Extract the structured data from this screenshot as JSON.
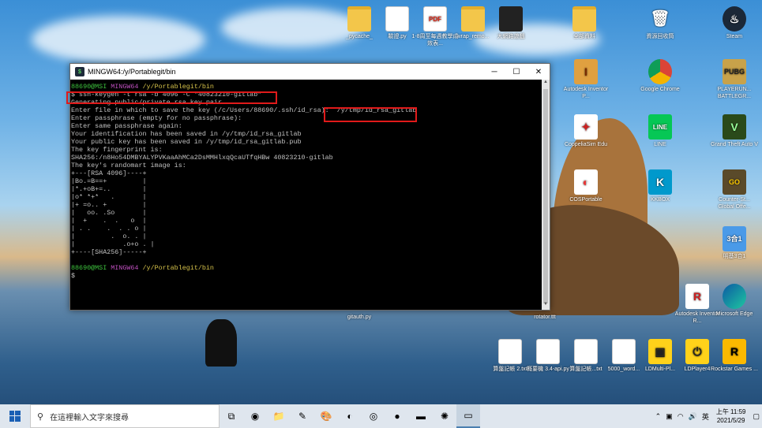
{
  "window": {
    "title": "MINGW64:/y/Portablegit/bin",
    "minimize": "─",
    "maximize": "☐",
    "close": "✕"
  },
  "terminal": {
    "lines": [
      {
        "user": "88690@MSI",
        "env": "MINGW64",
        "path": "/y/Portablegit/bin"
      },
      "$ ssh-keygen -t rsa -b 4096 -C \"40823210-gitlab\"",
      "Generating public/private rsa key pair.",
      "Enter file in which to save the key (/c/Users/88690/.ssh/id_rsa):  /y/tmp/id_rsa_gitlab",
      "Enter passphrase (empty for no passphrase):",
      "Enter same passphrase again:",
      "Your identification has been saved in /y/tmp/id_rsa_gitlab",
      "Your public key has been saved in /y/tmp/id_rsa_gitlab.pub",
      "The key fingerprint is:",
      "SHA256:/n8Ho54DMBYALYPVKaaAhMCa2DsMMHlxqQcaUTfqHBw 40823210-gitlab",
      "The key's randomart image is:",
      "+---[RSA 4096]----+",
      "|Bo.=B==+         |",
      "|*.+oB+=..        |",
      "|o* *+*   .       |",
      "|+ =o.. +         |",
      "|   oo. .So       |",
      "|  +    .  .   o  |",
      "| . .    .  . . o |",
      "|         .  o. . |",
      "|            .o+o . |",
      "+----[SHA256]-----+",
      "",
      {
        "user": "88690@MSI",
        "env": "MINGW64",
        "path": "/y/Portablegit/bin"
      },
      "$"
    ]
  },
  "desktop_icons": [
    {
      "label": "_pycache_",
      "icon": "folder"
    },
    {
      "label": "驗證.py",
      "icon": "doc"
    },
    {
      "label": "1-8周至每週教學成效表...",
      "icon": "pdf"
    },
    {
      "label": "wrap_remo...",
      "icon": "folder"
    },
    {
      "label": "大網路遊戲",
      "icon": "folder"
    },
    {
      "label": "全部資料",
      "icon": "folder"
    },
    {
      "label": "資源回收筒",
      "icon": "recycle"
    },
    {
      "label": "Steam",
      "icon": "steam"
    },
    {
      "label": "Autodesk Inventor P...",
      "icon": "inventor"
    },
    {
      "label": "Google Chrome",
      "icon": "chrome"
    },
    {
      "label": "PLAYERUN... BATTLEGR...",
      "icon": "pubg"
    },
    {
      "label": "CoppeliaSim Edu",
      "icon": "coppelia"
    },
    {
      "label": "LINE",
      "icon": "line"
    },
    {
      "label": "Grand Theft Auto V",
      "icon": "gta"
    },
    {
      "label": "COSPortable",
      "icon": "cos"
    },
    {
      "label": "KKBOX",
      "icon": "kkbox"
    },
    {
      "label": "Counter-St... Global Offe...",
      "icon": "csgo"
    },
    {
      "label": "明基3合1",
      "icon": "benq"
    },
    {
      "label": "Autodesk Inventor R...",
      "icon": "inventor2"
    },
    {
      "label": "Microsoft Edge",
      "icon": "edge"
    },
    {
      "label": "gitauth.py",
      "icon": "doc"
    },
    {
      "label": "rotator.ttt",
      "icon": "doc"
    },
    {
      "label": "算盤記帳 2.txt",
      "icon": "doc"
    },
    {
      "label": "概要機 3.4-api.py",
      "icon": "doc"
    },
    {
      "label": "算盤記帳...txt",
      "icon": "doc"
    },
    {
      "label": "5000_word...",
      "icon": "doc"
    },
    {
      "label": "LDMulti-Pl...",
      "icon": "ldmulti"
    },
    {
      "label": "LDPlayer4",
      "icon": "ldplayer"
    },
    {
      "label": "Rockstar Games ...",
      "icon": "rockstar"
    }
  ],
  "taskbar": {
    "search_placeholder": "在這裡輸入文字來搜尋",
    "ime": "英",
    "time": "上午 11:59",
    "date": "2021/5/29"
  }
}
